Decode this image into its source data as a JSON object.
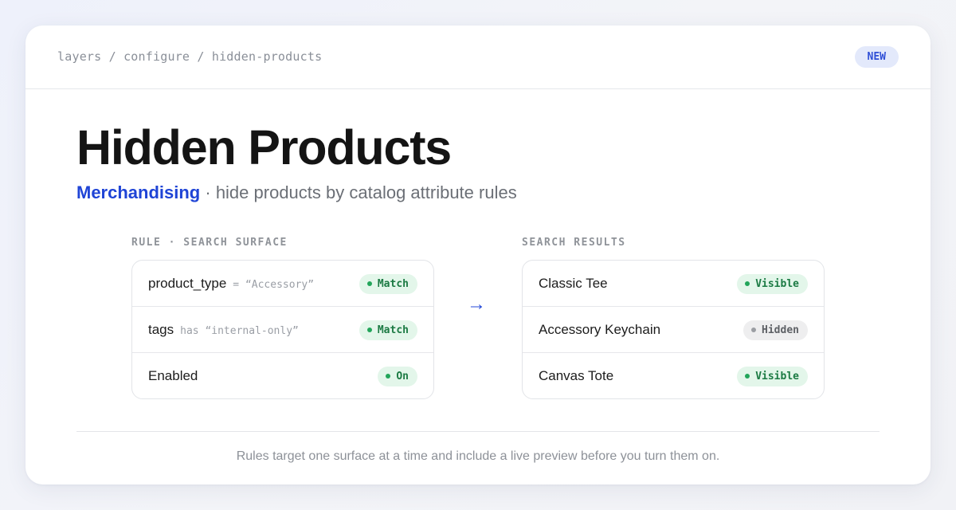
{
  "breadcrumb": "layers / configure / hidden-products",
  "badge": "NEW",
  "title": "Hidden Products",
  "subtitle": {
    "category": "Merchandising",
    "separator": " · ",
    "description": "hide products by catalog attribute rules"
  },
  "rule_panel": {
    "label": "RULE · SEARCH SURFACE",
    "rows": [
      {
        "name": "product_type",
        "condition": "= “Accessory”",
        "status": "Match",
        "tone": "green"
      },
      {
        "name": "tags",
        "condition": "has “internal-only”",
        "status": "Match",
        "tone": "green"
      },
      {
        "name": "Enabled",
        "condition": "",
        "status": "On",
        "tone": "green"
      }
    ]
  },
  "arrow": "→",
  "results_panel": {
    "label": "SEARCH RESULTS",
    "rows": [
      {
        "name": "Classic Tee",
        "status": "Visible",
        "tone": "green"
      },
      {
        "name": "Accessory Keychain",
        "status": "Hidden",
        "tone": "gray"
      },
      {
        "name": "Canvas Tote",
        "status": "Visible",
        "tone": "green"
      }
    ]
  },
  "footer": "Rules target one surface at a time and include a live preview before you turn them on.",
  "colors": {
    "accent": "#1f44d6",
    "status_green": "#1b7a43",
    "status_gray": "#5e6166",
    "badge_bg": "#e3e9fb"
  }
}
